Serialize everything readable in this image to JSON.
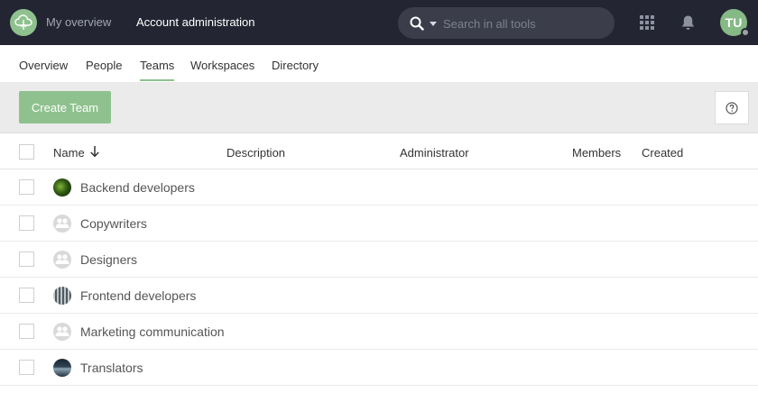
{
  "topbar": {
    "nav": [
      {
        "label": "My overview"
      },
      {
        "label": "Account administration"
      }
    ],
    "search": {
      "placeholder": "Search in all tools",
      "value": ""
    },
    "avatar_initials": "TU"
  },
  "tabs": [
    {
      "label": "Overview",
      "active": false
    },
    {
      "label": "People",
      "active": false
    },
    {
      "label": "Teams",
      "active": true
    },
    {
      "label": "Workspaces",
      "active": false
    },
    {
      "label": "Directory",
      "active": false
    }
  ],
  "toolbar": {
    "create_label": "Create Team"
  },
  "table": {
    "columns": [
      "Name",
      "Description",
      "Administrator",
      "Members",
      "Created"
    ],
    "sort": {
      "column": "Name",
      "direction": "descending"
    },
    "rows": [
      {
        "name": "Backend developers",
        "avatar": "green-photo"
      },
      {
        "name": "Copywriters",
        "avatar": "default-team"
      },
      {
        "name": "Designers",
        "avatar": "default-team"
      },
      {
        "name": "Frontend developers",
        "avatar": "striped-photo"
      },
      {
        "name": "Marketing communication",
        "avatar": "default-team"
      },
      {
        "name": "Translators",
        "avatar": "dark-photo"
      }
    ]
  },
  "colors": {
    "topbar": "#232532",
    "accent": "#8fc18f",
    "toolbar": "#ebebeb"
  }
}
